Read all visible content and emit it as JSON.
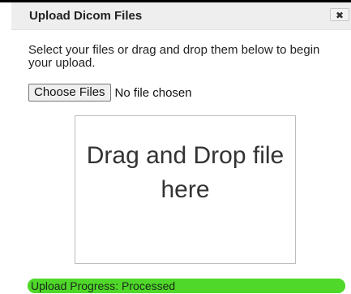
{
  "dialog": {
    "title": "Upload Dicom Files",
    "close_icon": "close-icon",
    "close_glyph": "✖"
  },
  "instructions": "Select your files or drag and drop them below to begin your upload.",
  "file_input": {
    "button_label": "Choose Files",
    "status_text": "No file chosen"
  },
  "drop_zone": {
    "text": "Drag and Drop file here"
  },
  "progress": {
    "label": "Upload Progress: Processed",
    "fraction": 1.0,
    "color": "#4fd829"
  },
  "colors": {
    "title_bar": "#eeeeee",
    "progress_green": "#5de23a"
  }
}
